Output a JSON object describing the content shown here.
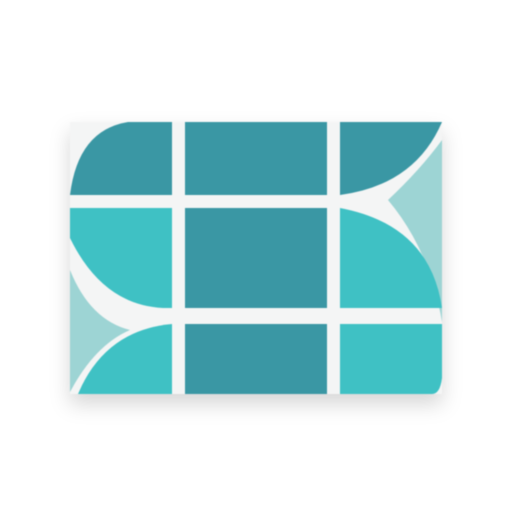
{
  "logo": {
    "icon": "tile-mosaic-s-logo-icon",
    "colors": {
      "dark_teal": "#3A97A4",
      "bright_teal": "#3FC1C4",
      "pale_teal": "#9DD4D4",
      "gap": "#F4F5F5"
    }
  }
}
